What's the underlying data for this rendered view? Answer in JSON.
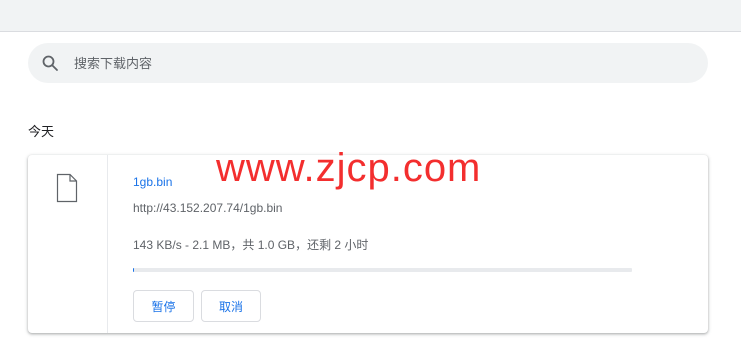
{
  "search": {
    "placeholder": "搜索下载内容",
    "icon": "search-icon"
  },
  "date_group": "今天",
  "download": {
    "file_name": "1gb.bin",
    "url": "http://43.152.207.74/1gb.bin",
    "status": "143 KB/s - 2.1 MB，共 1.0 GB，还剩 2 小时",
    "progress_percent": 0.2,
    "pause_label": "暂停",
    "cancel_label": "取消",
    "icon": "file-icon"
  },
  "watermark": "www.zjcp.com",
  "colors": {
    "accent": "#1a73e8",
    "secondary_text": "#5f6368",
    "watermark": "#f21d1d",
    "search_bg": "#f1f3f4"
  }
}
